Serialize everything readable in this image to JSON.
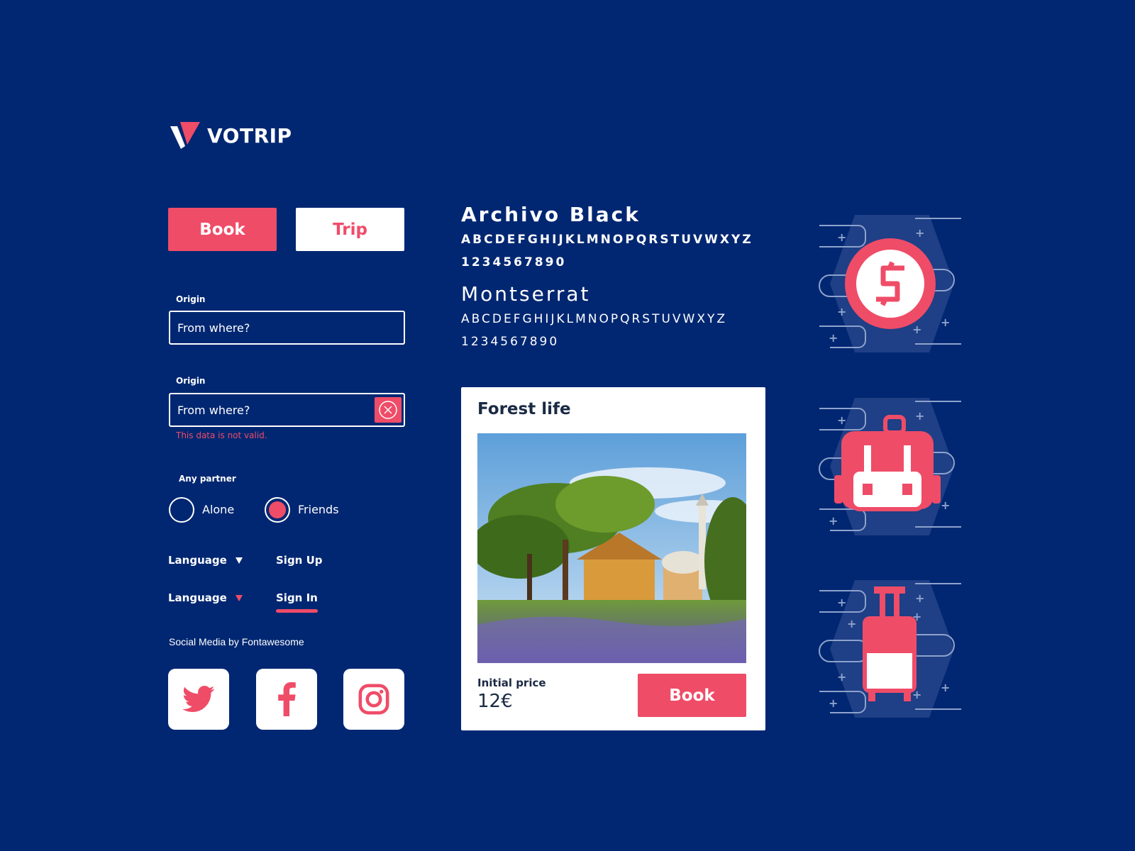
{
  "brand": {
    "name": "VOTRIP",
    "accent": "#ef4c68",
    "background": "#012772"
  },
  "tabs": {
    "book_label": "Book",
    "trip_label": "Trip"
  },
  "form": {
    "origin_label_1": "Origin",
    "origin_placeholder_1": "From where?",
    "origin_label_2": "Origin",
    "origin_placeholder_2": "From where?",
    "error_text": "This data is not valid."
  },
  "partner": {
    "label": "Any partner",
    "options": [
      {
        "label": "Alone",
        "selected": false
      },
      {
        "label": "Friends",
        "selected": true
      }
    ]
  },
  "nav": {
    "language_1": "Language",
    "signup": "Sign Up",
    "language_2": "Language",
    "signin": "Sign In"
  },
  "social": {
    "caption": "Social Media by Fontawesome",
    "icons": [
      "twitter-icon",
      "facebook-icon",
      "instagram-icon"
    ]
  },
  "typography": {
    "font1_name": "Archivo Black",
    "font1_alphabet": "ABCDEFGHIJKLMNOPQRSTUVWXYZ",
    "font1_digits": "1234567890",
    "font2_name": "Montserrat",
    "font2_alphabet": "ABCDEFGHIJKLMNOPQRSTUVWXYZ",
    "font2_digits": "1234567890"
  },
  "card": {
    "title": "Forest life",
    "price_label": "Initial price",
    "price_value": "12€",
    "book_label": "Book"
  },
  "illustrations": [
    "dollar-coin-icon",
    "backpack-icon",
    "suitcase-icon"
  ]
}
